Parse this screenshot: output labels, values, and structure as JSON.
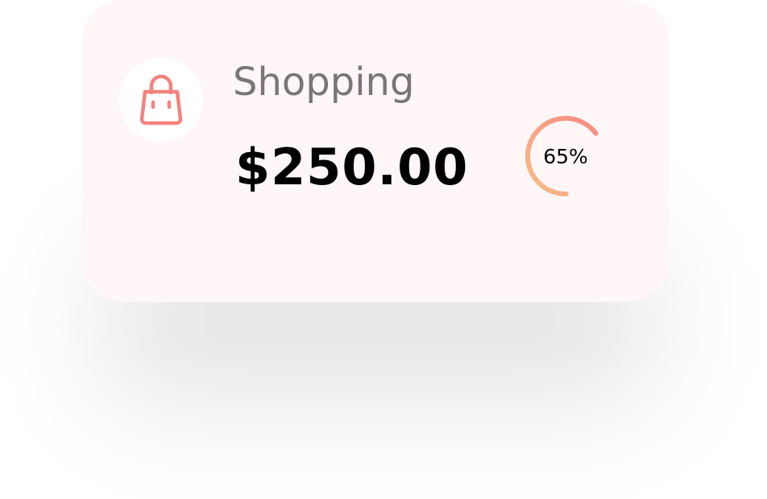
{
  "card": {
    "category": "Shopping",
    "icon": "shopping-bag-icon",
    "amount": "$250.00",
    "progress": {
      "value": 0.65,
      "label": "65%",
      "gradient_start": "#f98b84",
      "gradient_end": "#f7bc86"
    },
    "background": "#fff7f7",
    "accent": "#f4827e"
  }
}
